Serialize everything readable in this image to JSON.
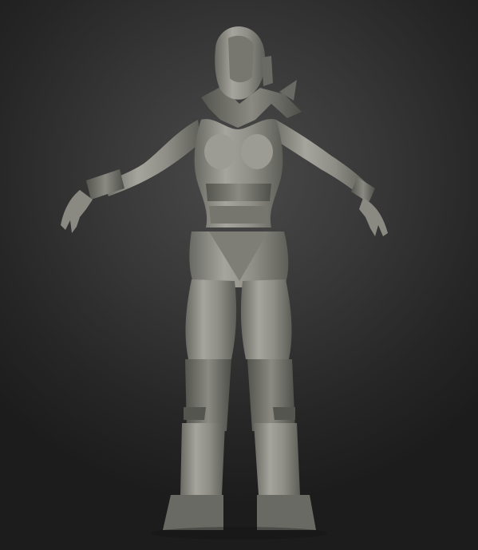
{
  "scene": {
    "subject": "sculpt-render-female-armored-figure",
    "palette": {
      "background_top": "#4a4a4a",
      "background_bottom": "#1c1c1c",
      "clay_light": "#a3a39b",
      "clay_mid": "#85857e",
      "clay_dark": "#5a5a55"
    }
  }
}
